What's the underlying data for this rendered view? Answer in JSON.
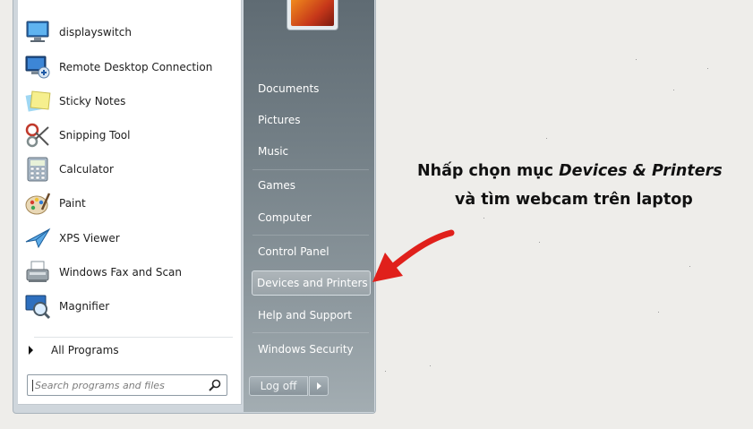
{
  "start_menu": {
    "programs": [
      {
        "label": "displayswitch",
        "icon": "display-switch-icon"
      },
      {
        "label": "Remote Desktop Connection",
        "icon": "remote-desktop-icon"
      },
      {
        "label": "Sticky Notes",
        "icon": "sticky-notes-icon"
      },
      {
        "label": "Snipping Tool",
        "icon": "scissors-icon"
      },
      {
        "label": "Calculator",
        "icon": "calculator-icon"
      },
      {
        "label": "Paint",
        "icon": "paint-palette-icon"
      },
      {
        "label": "XPS Viewer",
        "icon": "xps-viewer-icon"
      },
      {
        "label": "Windows Fax and Scan",
        "icon": "fax-scanner-icon"
      },
      {
        "label": "Magnifier",
        "icon": "magnifier-icon"
      }
    ],
    "all_programs_label": "All Programs",
    "search_placeholder": "Search programs and files",
    "places": [
      {
        "label": "Documents"
      },
      {
        "label": "Pictures"
      },
      {
        "label": "Music"
      },
      {
        "label": "Games"
      },
      {
        "label": "Computer"
      },
      {
        "label": "Control Panel"
      },
      {
        "label": "Devices and Printers",
        "highlighted": true
      },
      {
        "label": "Help and Support"
      },
      {
        "label": "Windows Security"
      }
    ],
    "logoff_label": "Log off"
  },
  "annotation": {
    "line1_prefix": "Nhấp chọn mục ",
    "line1_emphasis": "Devices & Printers",
    "line2": "và tìm webcam trên laptop",
    "arrow_color": "#e0201b"
  },
  "colors": {
    "background": "#eeedea",
    "right_pane": "#6f7b82",
    "highlight_border": "#d6dde2"
  }
}
